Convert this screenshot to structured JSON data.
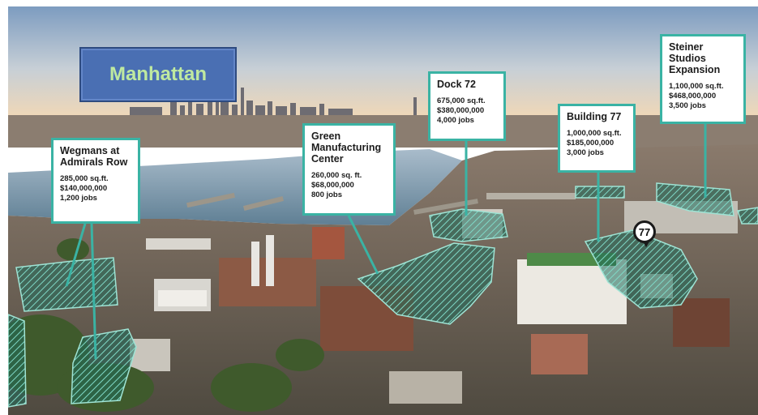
{
  "overlay": {
    "manhattan_label": "Manhattan",
    "pin_label": "77"
  },
  "sites": [
    {
      "title": "Wegmans at\nAdmirals Row",
      "stats": "285,000 sq.ft.\n$140,000,000\n1,200 jobs"
    },
    {
      "title": "Green\nManufacturing\nCenter",
      "stats": "260,000 sq. ft.\n$68,000,000\n800 jobs"
    },
    {
      "title": "Dock 72",
      "stats": "675,000 sq.ft.\n$380,000,000\n4,000 jobs"
    },
    {
      "title": "Building 77",
      "stats": "1,000,000 sq.ft.\n$185,000,000\n3,000 jobs"
    },
    {
      "title": "Steiner\nStudios\nExpansion",
      "stats": "1,100,000 sq.ft.\n$468,000,000\n3,500 jobs"
    }
  ],
  "colors": {
    "accent_teal": "#3ab3a4",
    "sky_top": "#7d9cc0",
    "sky_horizon": "#f2d8b5",
    "water": "#7ea3b8",
    "label_bg": "#4a6fb3",
    "label_text": "#bfe9a0"
  }
}
